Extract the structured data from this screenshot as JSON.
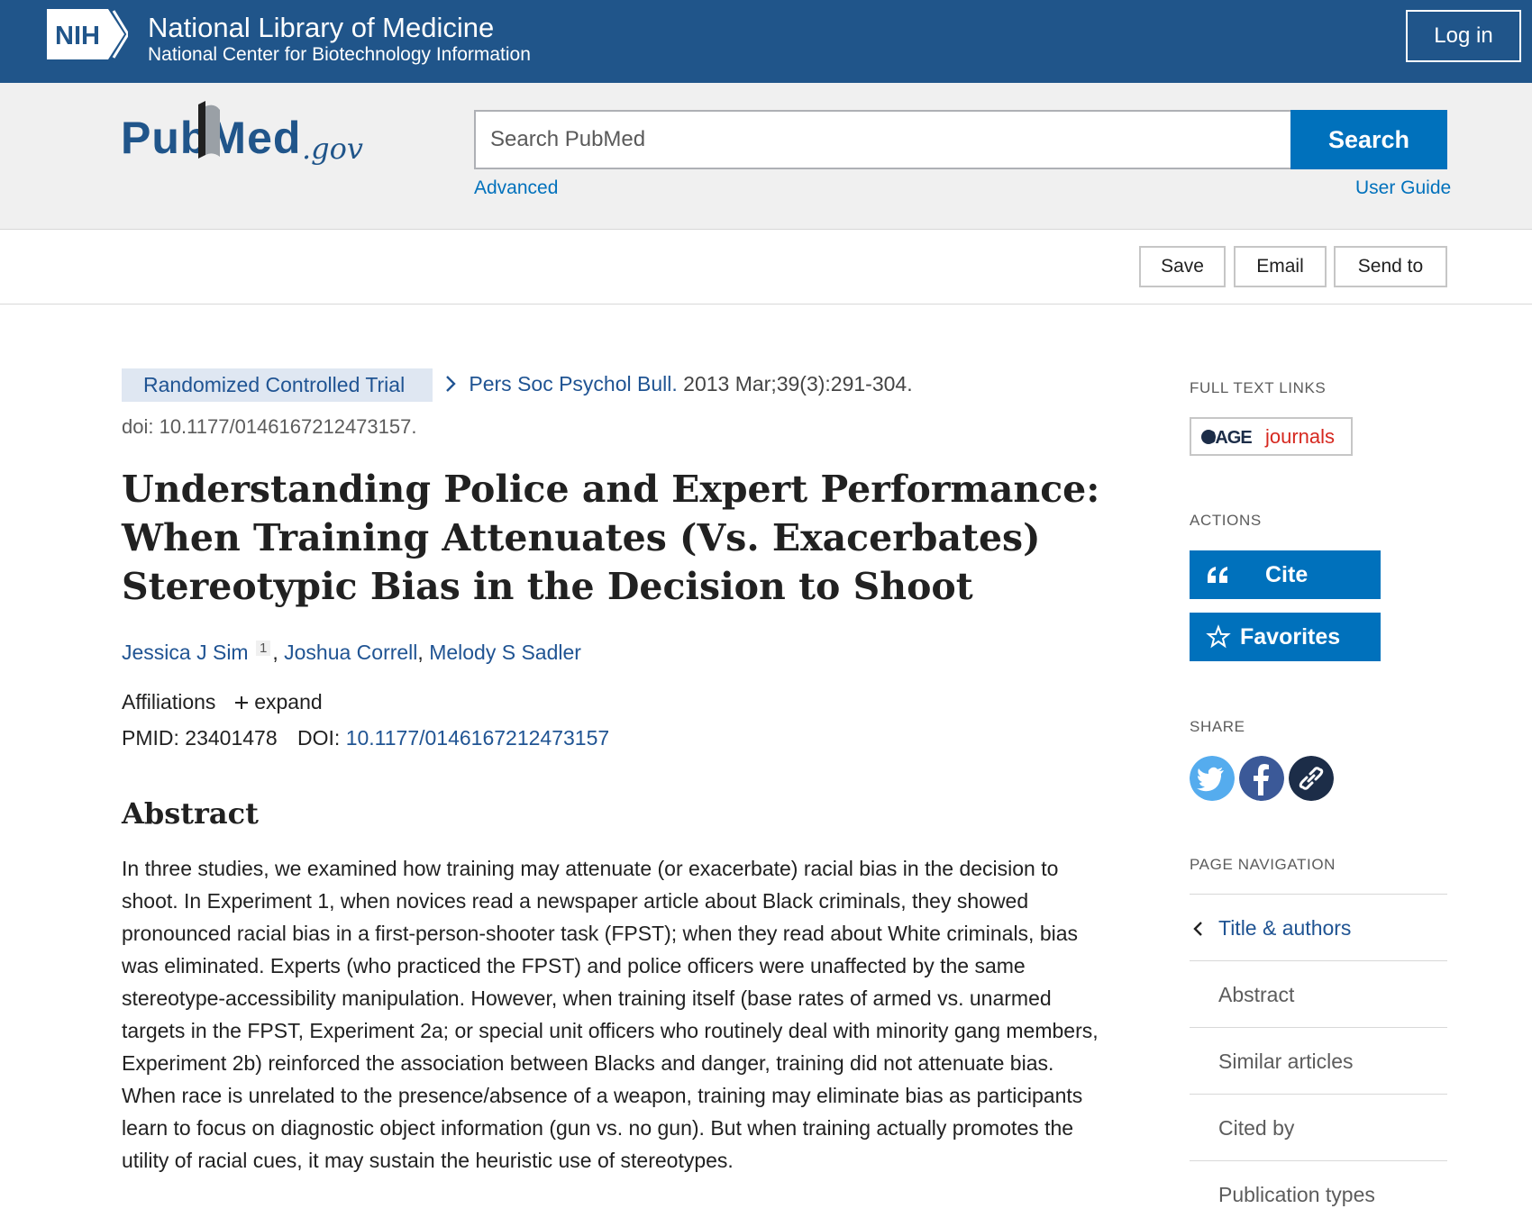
{
  "nih": {
    "logo_text": "NIH",
    "title": "National Library of Medicine",
    "subtitle": "National Center for Biotechnology Information",
    "login_label": "Log in"
  },
  "search": {
    "logo_text": "PubMed",
    "logo_suffix": ".gov",
    "placeholder": "Search PubMed",
    "button_label": "Search",
    "advanced_label": "Advanced",
    "user_guide_label": "User Guide"
  },
  "toolbar": {
    "save_label": "Save",
    "email_label": "Email",
    "send_to_label": "Send to"
  },
  "article": {
    "pub_type": "Randomized Controlled Trial",
    "journal": "Pers Soc Psychol Bull.",
    "citation": "2013 Mar;39(3):291-304.",
    "doi_line": "doi: 10.1177/0146167212473157.",
    "title": "Understanding Police and Expert Performance: When Training Attenuates (Vs. Exacerbates) Stereotypic Bias in the Decision to Shoot",
    "authors": [
      {
        "name": "Jessica J Sim",
        "affil_num": "1"
      },
      {
        "name": "Joshua Correll"
      },
      {
        "name": "Melody S Sadler"
      }
    ],
    "affiliations_label": "Affiliations",
    "expand_label": "expand",
    "pmid_label": "PMID:",
    "pmid": "23401478",
    "doi_label": "DOI:",
    "doi": "10.1177/0146167212473157",
    "abstract_heading": "Abstract",
    "abstract": "In three studies, we examined how training may attenuate (or exacerbate) racial bias in the decision to shoot. In Experiment 1, when novices read a newspaper article about Black criminals, they showed pronounced racial bias in a first-person-shooter task (FPST); when they read about White criminals, bias was eliminated. Experts (who practiced the FPST) and police officers were unaffected by the same stereotype-accessibility manipulation. However, when training itself (base rates of armed vs. unarmed targets in the FPST, Experiment 2a; or special unit officers who routinely deal with minority gang members, Experiment 2b) reinforced the association between Blacks and danger, training did not attenuate bias. When race is unrelated to the presence/absence of a weapon, training may eliminate bias as participants learn to focus on diagnostic object information (gun vs. no gun). But when training actually promotes the utility of racial cues, it may sustain the heuristic use of stereotypes."
  },
  "sidebar": {
    "full_text_heading": "FULL TEXT LINKS",
    "sage_brand": "SAGE",
    "sage_suffix": "journals",
    "actions_heading": "ACTIONS",
    "cite_label": "Cite",
    "favorites_label": "Favorites",
    "share_heading": "SHARE",
    "share_icons": [
      "twitter-icon",
      "facebook-icon",
      "link-icon"
    ],
    "nav_heading": "PAGE NAVIGATION",
    "nav_items": [
      {
        "label": "Title & authors"
      },
      {
        "label": "Abstract"
      },
      {
        "label": "Similar articles"
      },
      {
        "label": "Cited by"
      },
      {
        "label": "Publication types"
      }
    ]
  },
  "colors": {
    "nih_blue": "#20558a",
    "primary_blue": "#0071bc",
    "link_blue": "#205493",
    "header_bg": "#f0f0f0",
    "twitter": "#55acee",
    "facebook": "#3b5998",
    "link_share": "#1c2d48"
  }
}
